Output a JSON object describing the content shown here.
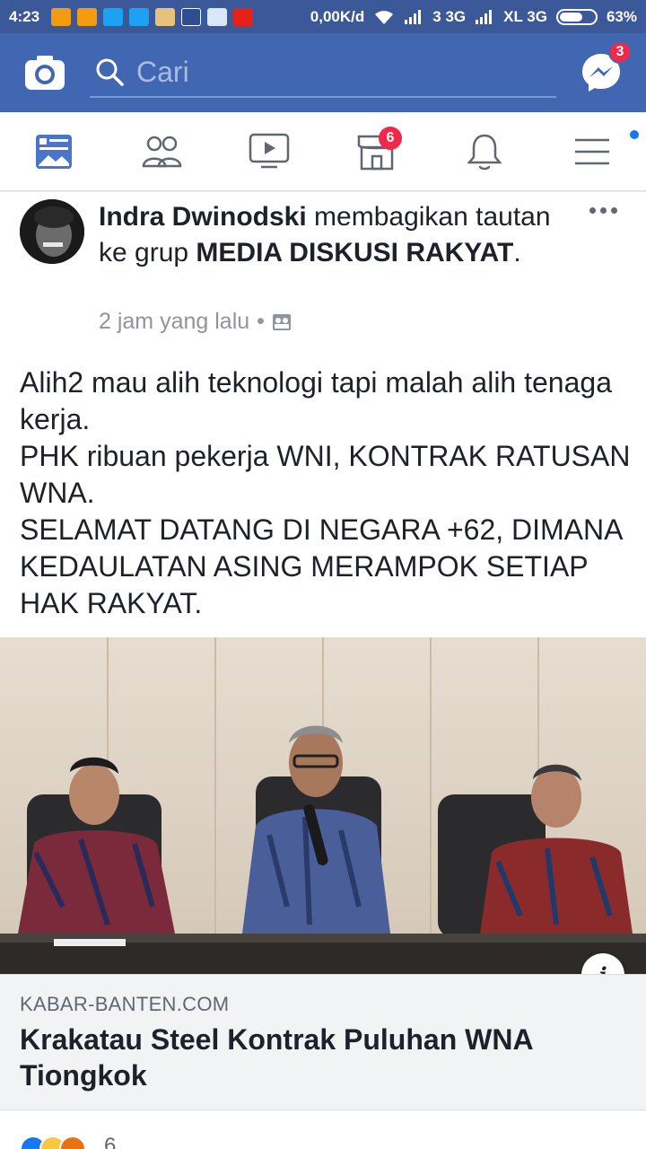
{
  "status_bar": {
    "time": "4:23",
    "net_speed": "0,00K/d",
    "carrier1": "3 3G",
    "carrier2": "XL 3G",
    "battery": "63%"
  },
  "top_bar": {
    "search_placeholder": "Cari",
    "messenger_badge": "3"
  },
  "nav_tabs": {
    "marketplace_badge": "6"
  },
  "post": {
    "author": "Indra Dwinodski",
    "action": " membagikan tautan ke grup ",
    "group": "MEDIA DISKUSI RAKYAT",
    "period": ".",
    "time": "2 jam yang lalu",
    "separator": "•",
    "body": "Alih2 mau alih teknologi tapi malah alih tenaga kerja.\nPHK ribuan pekerja WNI, KONTRAK RATUSAN WNA.\nSELAMAT DATANG DI NEGARA +62, DIMANA KEDAULATAN ASING MERAMPOK SETIAP HAK RAKYAT.",
    "link": {
      "info_icon_text": "i",
      "domain": "KABAR-BANTEN.COM",
      "title": "Krakatau Steel Kontrak Puluhan WNA Tiongkok"
    },
    "reactions": {
      "count": "6"
    }
  },
  "colors": {
    "brand": "#4267b2",
    "status_bar": "#3b5998",
    "badge": "#f02849",
    "link_bg": "#f2f3f5"
  }
}
